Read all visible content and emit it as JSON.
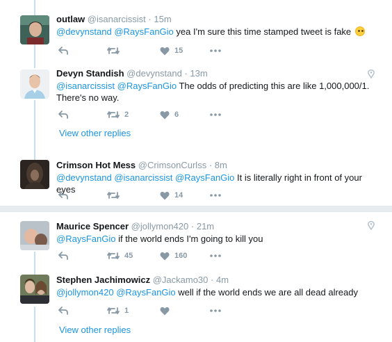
{
  "thread1": {
    "tweets": [
      {
        "name": "outlaw",
        "handle": "@isanarcissist",
        "dot": "·",
        "time": "15m",
        "mentions": [
          "@devynstand",
          "@RaysFanGio"
        ],
        "text": "yea I'm sure this time stamped tweet is fake",
        "emoji": "face-with-rolling-eyes",
        "retweets": "",
        "likes": "15"
      },
      {
        "name": "Devyn Standish",
        "handle": "@devynstand",
        "dot": "·",
        "time": "13m",
        "mentions": [
          "@isanarcissist",
          "@RaysFanGio"
        ],
        "text": "The odds of predicting this are like 1,000,000/1.",
        "text2": "There's no way.",
        "retweets": "2",
        "likes": "6",
        "location_icon": "location-pin-icon"
      }
    ],
    "view_other": "View other replies",
    "tweet3": {
      "name": "Crimson Hot Mess",
      "handle": "@CrimsonCurlss",
      "dot": "·",
      "time": "8m",
      "mentions": [
        "@devynstand",
        "@isanarcissist",
        "@RaysFanGio"
      ],
      "text": "It is literally right in front of your eyes",
      "retweets": "",
      "likes": "14"
    }
  },
  "thread2": {
    "tweets": [
      {
        "name": "Maurice Spencer",
        "handle": "@jollymon420",
        "dot": "·",
        "time": "21m",
        "mentions": [
          "@RaysFanGio"
        ],
        "text": "if the world ends I'm going to kill you",
        "retweets": "45",
        "likes": "160",
        "location_icon": "location-pin-icon"
      },
      {
        "name": "Stephen Jachimowicz",
        "handle": "@Jackamo30",
        "dot": "·",
        "time": "4m",
        "mentions": [
          "@jollymon420",
          "@RaysFanGio"
        ],
        "text": "well if the world ends we are all dead already",
        "retweets": "1",
        "likes": ""
      }
    ],
    "view_other": "View other replies"
  },
  "colors": {
    "accent": "#1b95e0",
    "muted": "#8899a6",
    "thread_line": "#c4e0f5",
    "separator": "#e6ecf0"
  }
}
